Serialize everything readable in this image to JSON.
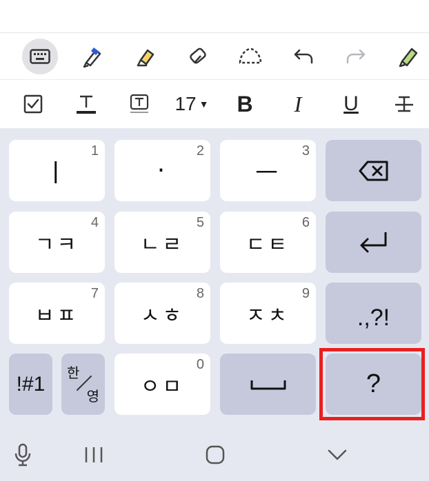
{
  "toolbar_top": {
    "tools": [
      {
        "name": "keyboard-toggle",
        "icon": "keyboard-icon",
        "active": true
      },
      {
        "name": "pen",
        "icon": "pen-icon"
      },
      {
        "name": "highlighter",
        "icon": "highlighter-icon"
      },
      {
        "name": "eraser",
        "icon": "eraser-icon"
      },
      {
        "name": "lasso",
        "icon": "lasso-icon"
      },
      {
        "name": "undo",
        "icon": "undo-icon"
      },
      {
        "name": "redo",
        "icon": "redo-icon",
        "disabled": true
      },
      {
        "name": "pen-settings",
        "icon": "multicolor-pen-icon"
      }
    ]
  },
  "toolbar_format": {
    "font_size": "17",
    "bold_label": "B",
    "italic_label": "I",
    "underline_label": "U",
    "tools": [
      "checkbox-icon",
      "text-color-icon",
      "text-box-icon",
      "font-size",
      "bold",
      "italic",
      "underline",
      "strikethrough"
    ]
  },
  "keyboard": {
    "keys": [
      {
        "id": "key-1",
        "label": "ㅣ",
        "number": "1"
      },
      {
        "id": "key-2",
        "label": "·",
        "number": "2"
      },
      {
        "id": "key-3",
        "label": "ㅡ",
        "number": "3"
      },
      {
        "id": "key-4",
        "label": "ㄱㅋ",
        "number": "4"
      },
      {
        "id": "key-5",
        "label": "ㄴㄹ",
        "number": "5"
      },
      {
        "id": "key-6",
        "label": "ㄷㅌ",
        "number": "6"
      },
      {
        "id": "key-7",
        "label": "ㅂㅍ",
        "number": "7"
      },
      {
        "id": "key-8",
        "label": "ㅅㅎ",
        "number": "8"
      },
      {
        "id": "key-9",
        "label": "ㅈㅊ",
        "number": "9"
      },
      {
        "id": "key-0",
        "label": "ㅇㅁ",
        "number": "0"
      }
    ],
    "punct_label": ".,?!",
    "symbols_label": "!#1",
    "lang_top": "한",
    "lang_bottom": "영",
    "question_label": "?",
    "colors": {
      "key_bg": "#ffffff",
      "func_key_bg": "#c6c9dc",
      "keyboard_bg": "#e6e8f1",
      "highlight": "#e8201f",
      "pen_blue": "#2f5bd8",
      "highlighter_yellow": "#f2d36b"
    }
  },
  "navbar": {
    "icons": [
      "microphone-icon",
      "recent-apps-icon",
      "home-icon",
      "hide-keyboard-icon"
    ]
  }
}
